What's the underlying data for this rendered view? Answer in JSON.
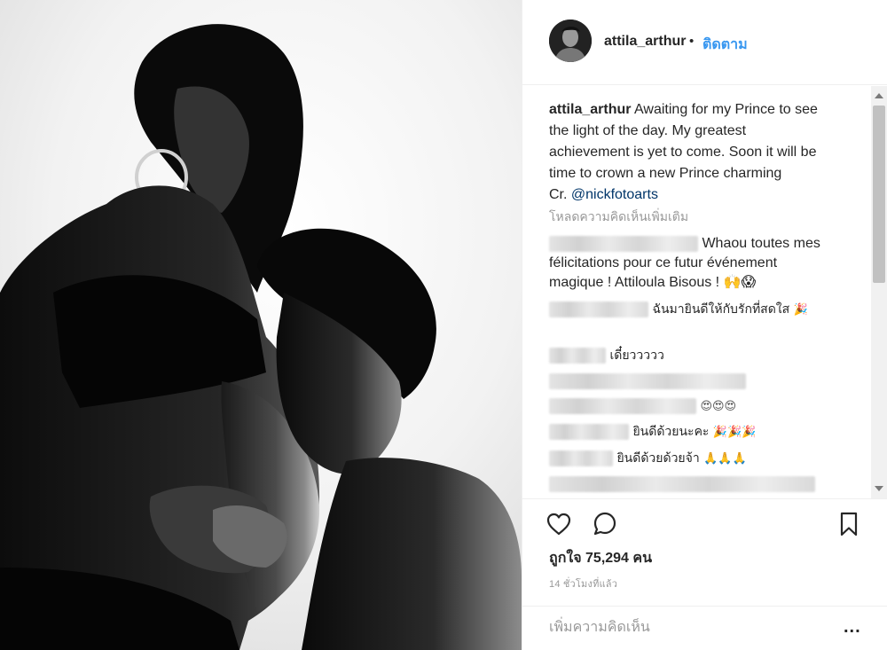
{
  "post": {
    "username": "attila_arthur",
    "dot": "•",
    "follow_label": "ติดตาม",
    "caption": {
      "username": "attila_arthur",
      "lines": [
        "Awaiting for my Prince to see",
        "the light of the day. My greatest",
        "achievement is yet to come. Soon it will be",
        "time to crown a new Prince charming"
      ],
      "credit_prefix": "Cr. ",
      "mention": "@nickfotoarts"
    },
    "load_more": "โหลดความคิดเห็นเพิ่มเติม",
    "comments": [
      {
        "lines": [
          "Whaou toutes mes",
          "félicitations pour ce futur événement",
          "magique ! Attiloula Bisous ! 🙌😱"
        ]
      },
      {
        "text": "ฉันมายินดีให้กับรักที่สดใส",
        "emoji": "🎉"
      },
      {
        "text": "เดี๋ยววววว"
      },
      {
        "text": ""
      },
      {
        "text": "",
        "emoji": "😍😍😍"
      },
      {
        "text": "ยินดีด้วยนะคะ",
        "emoji": "🎉🎉🎉"
      },
      {
        "text": "ยินดีด้วยด้วยจ้า",
        "emoji": "🙏🙏🙏"
      },
      {
        "text": ""
      }
    ],
    "icons": {
      "like": "heart-icon",
      "comment": "comment-icon",
      "save": "bookmark-icon"
    },
    "likes_prefix": "ถูกใจ",
    "likes_count": "75,294",
    "likes_suffix": "คน",
    "time_ago": "14 ชั่วโมงที่แล้ว",
    "add_comment_placeholder": "เพิ่มความคิดเห็น",
    "more_options": "...",
    "colors": {
      "accent": "#3897f0",
      "mention": "#003569",
      "muted": "#999999",
      "text": "#262626"
    }
  }
}
